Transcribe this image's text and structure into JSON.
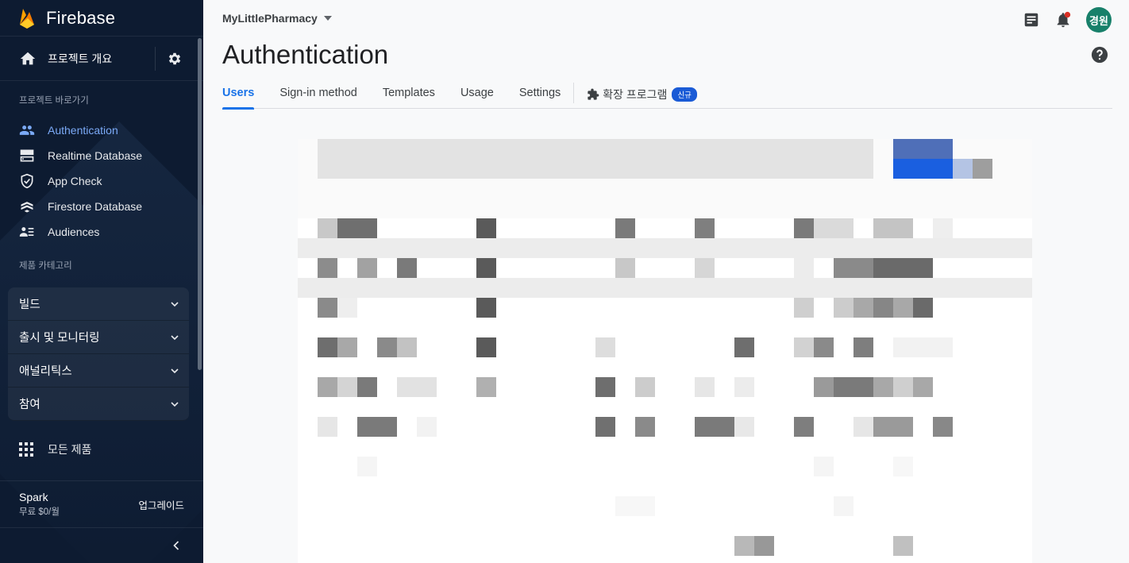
{
  "sidebar": {
    "brand": "Firebase",
    "overview_label": "프로젝트 개요",
    "shortcuts_title": "프로젝트 바로가기",
    "shortcuts": [
      {
        "label": "Authentication",
        "icon": "people-icon",
        "active": true
      },
      {
        "label": "Realtime Database",
        "icon": "database-icon",
        "active": false
      },
      {
        "label": "App Check",
        "icon": "shield-check-icon",
        "active": false
      },
      {
        "label": "Firestore Database",
        "icon": "firestore-icon",
        "active": false
      },
      {
        "label": "Audiences",
        "icon": "audiences-icon",
        "active": false
      }
    ],
    "categories_title": "제품 카테고리",
    "categories": [
      "빌드",
      "출시 및 모니터링",
      "애널리틱스",
      "참여"
    ],
    "all_products": "모든 제품",
    "plan": {
      "name": "Spark",
      "price": "무료 $0/월",
      "upgrade": "업그레이드"
    }
  },
  "header": {
    "project": "MyLittlePharmacy",
    "avatar_text": "경원"
  },
  "page": {
    "title": "Authentication",
    "tabs": [
      "Users",
      "Sign-in method",
      "Templates",
      "Usage",
      "Settings"
    ],
    "active_tab": "Users",
    "extensions_label": "확장 프로그램",
    "new_badge": "신규"
  },
  "colors": {
    "sidebar_bg": "#0d1b31",
    "accent": "#1a73e8",
    "active_nav": "#7baaf7",
    "avatar_bg": "#18806a"
  }
}
